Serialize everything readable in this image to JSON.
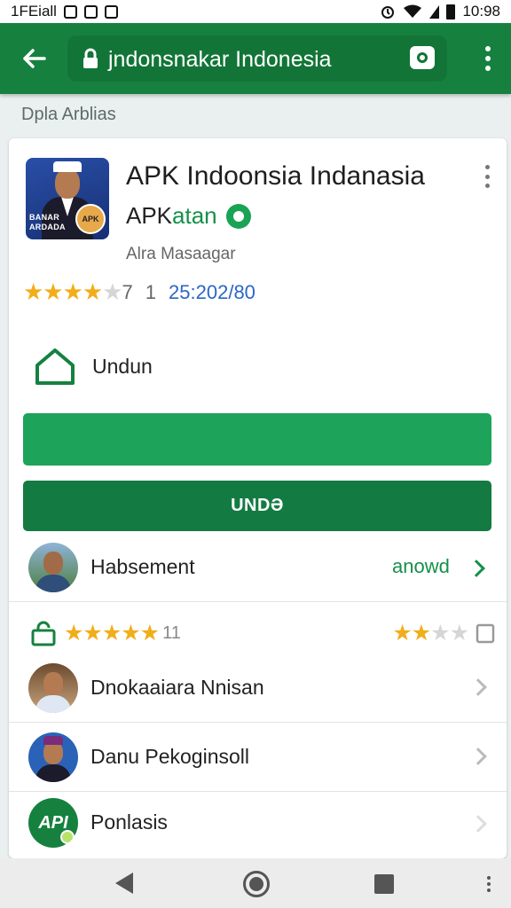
{
  "status_bar": {
    "left_text": "1FEiall",
    "time": "10:98",
    "icons": [
      "notification-square-icon",
      "notification-square-icon",
      "notification-square-icon",
      "alarm-icon",
      "wifi-icon",
      "signal-icon",
      "battery-icon"
    ]
  },
  "app_bar": {
    "url": "jndonsnakar Indonesia",
    "icons": [
      "back-arrow-icon",
      "lock-icon",
      "camera-icon",
      "overflow-menu-icon"
    ]
  },
  "section_label": "Dpla Arblias",
  "app": {
    "title": "APK Indoonsia Indanasia",
    "subtitle_prefix": "APK",
    "subtitle_green": "atan",
    "developer": "Alra Masaagar",
    "icon_text_band": "BANAR\nARDADA",
    "icon_badge": "APK",
    "rating_stars": "★★★★",
    "rating_dim_star": "★",
    "rating_suffix": "7",
    "rating_count": "1",
    "downloads": "25:202/80"
  },
  "install": {
    "undun_label": "Undun",
    "primary_button_label": "",
    "secondary_button_label": "UNDƏ"
  },
  "list": {
    "first_item": {
      "label": "Habsement",
      "link_label": "anowd"
    },
    "review_summary": {
      "left_stars": "★★★★★",
      "left_count": "11",
      "right_stars_filled": "★★",
      "right_stars_empty": "★★"
    },
    "items": [
      {
        "label": "Dnokaaiara Nnisan"
      },
      {
        "label": "Danu Pekoginsoll"
      },
      {
        "label": "Ponlasis",
        "avatar_text": "API"
      }
    ]
  },
  "colors": {
    "brand_green": "#16813f",
    "button_green": "#1ea35a",
    "button_dark_green": "#137a42",
    "star": "#f2ad1a",
    "link_blue": "#2c66c5"
  }
}
